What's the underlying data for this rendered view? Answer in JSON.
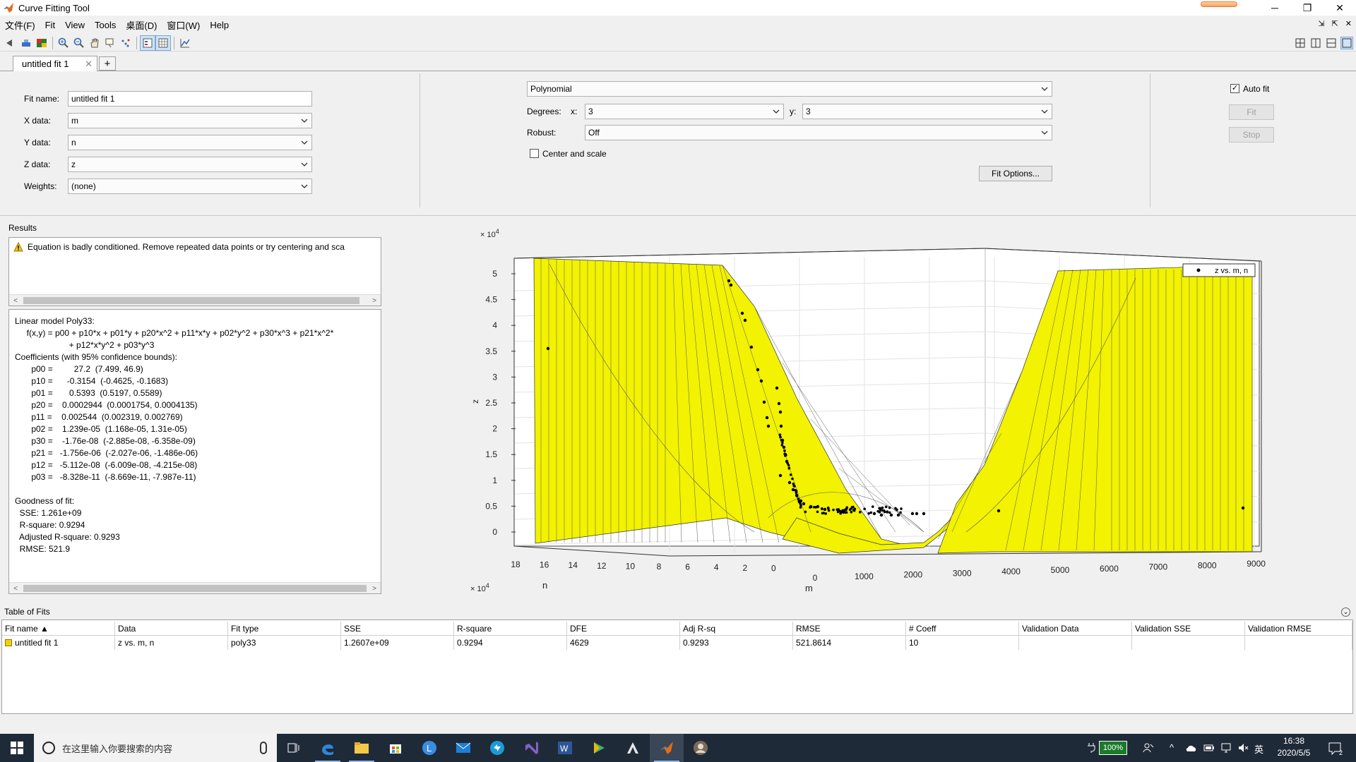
{
  "window": {
    "title": "Curve Fitting Tool",
    "controls": {
      "minimize": "─",
      "maximize": "❐",
      "close": "✕"
    }
  },
  "menubar": {
    "items": [
      "文件(F)",
      "Fit",
      "View",
      "Tools",
      "桌面(D)",
      "窗口(W)",
      "Help"
    ],
    "right_controls": [
      "⇲",
      "⇱",
      "✕"
    ]
  },
  "tabs": {
    "active_label": "untitled fit 1",
    "close": "✕",
    "add": "+"
  },
  "fit_settings": {
    "fit_name_label": "Fit name:",
    "fit_name_value": "untitled fit 1",
    "x_data_label": "X data:",
    "x_data_value": "m",
    "y_data_label": "Y data:",
    "y_data_value": "n",
    "z_data_label": "Z data:",
    "z_data_value": "z",
    "weights_label": "Weights:",
    "weights_value": "(none)",
    "fit_type_value": "Polynomial",
    "degrees_label": "Degrees:",
    "degree_x_label": "x:",
    "degree_x_value": "3",
    "degree_y_label": "y:",
    "degree_y_value": "3",
    "robust_label": "Robust:",
    "robust_value": "Off",
    "center_scale_label": "Center and scale",
    "center_scale_checked": false,
    "fit_options_label": "Fit Options...",
    "auto_fit_label": "Auto fit",
    "auto_fit_checked": true,
    "fit_button_label": "Fit",
    "stop_button_label": "Stop"
  },
  "results": {
    "title": "Results",
    "warning": "Equation is badly conditioned. Remove repeated data points or try centering and sca",
    "text_lines": [
      "Linear model Poly33:",
      "     f(x,y) = p00 + p10*x + p01*y + p20*x^2 + p11*x*y + p02*y^2 + p30*x^3 + p21*x^2*",
      "                       + p12*x*y^2 + p03*y^3",
      "Coefficients (with 95% confidence bounds):",
      "       p00 =         27.2  (7.499, 46.9)",
      "       p10 =      -0.3154  (-0.4625, -0.1683)",
      "       p01 =       0.5393  (0.5197, 0.5589)",
      "       p20 =    0.0002944  (0.0001754, 0.0004135)",
      "       p11 =    0.002544  (0.002319, 0.002769)",
      "       p02 =    1.239e-05  (1.168e-05, 1.31e-05)",
      "       p30 =    -1.76e-08  (-2.885e-08, -6.358e-09)",
      "       p21 =   -1.756e-06  (-2.027e-06, -1.486e-06)",
      "       p12 =   -5.112e-08  (-6.009e-08, -4.215e-08)",
      "       p03 =   -8.328e-11  (-8.669e-11, -7.987e-11)",
      "",
      "Goodness of fit:",
      "  SSE: 1.261e+09",
      "  R-square: 0.9294",
      "  Adjusted R-square: 0.9293",
      "  RMSE: 521.9"
    ],
    "scroll_left": "<",
    "scroll_right": ">"
  },
  "plot": {
    "z_exponent": "× 10",
    "z_exponent_power": "4",
    "y_exponent": "× 10",
    "y_exponent_power": "4",
    "zlabel": "z",
    "ylabel": "n",
    "xlabel": "m",
    "legend_label": "z vs. m, n",
    "surface_color": "#f2f201",
    "z_ticks": [
      "0",
      "0.5",
      "1",
      "1.5",
      "2",
      "2.5",
      "3",
      "3.5",
      "4",
      "4.5",
      "5"
    ],
    "n_ticks": [
      "18",
      "16",
      "14",
      "12",
      "10",
      "8",
      "6",
      "4",
      "2",
      "0"
    ],
    "m_ticks": [
      "0",
      "1000",
      "2000",
      "3000",
      "4000",
      "5000",
      "6000",
      "7000",
      "8000",
      "9000"
    ]
  },
  "table_of_fits": {
    "title": "Table of Fits",
    "collapse": "⌄",
    "columns": [
      "Fit name ▲",
      "Data",
      "Fit type",
      "SSE",
      "R-square",
      "DFE",
      "Adj R-sq",
      "RMSE",
      "# Coeff",
      "Validation Data",
      "Validation SSE",
      "Validation RMSE"
    ],
    "rows": [
      [
        "untitled fit 1",
        "z vs. m, n",
        "poly33",
        "1.2607e+09",
        "0.9294",
        "4629",
        "0.9293",
        "521.8614",
        "10",
        "",
        "",
        ""
      ]
    ]
  },
  "taskbar": {
    "search_placeholder": "在这里输入你要搜索的内容",
    "battery": "100%",
    "ime": "英",
    "time": "16:38",
    "date": "2020/5/5",
    "notification_count": "2"
  }
}
